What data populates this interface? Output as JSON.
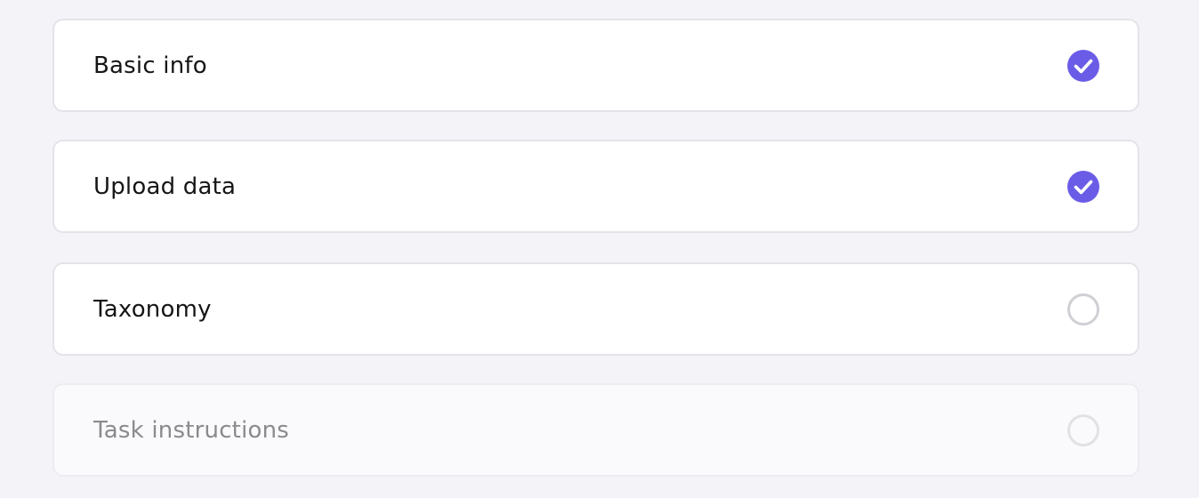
{
  "steps": [
    {
      "label": "Basic info",
      "status": "complete",
      "icon": "check-circle-icon"
    },
    {
      "label": "Upload data",
      "status": "complete",
      "icon": "check-circle-icon"
    },
    {
      "label": "Taxonomy",
      "status": "incomplete",
      "icon": "empty-circle-icon"
    },
    {
      "label": "Task instructions",
      "status": "disabled",
      "icon": "empty-circle-icon"
    }
  ],
  "colors": {
    "accent": "#6b5ce7",
    "incomplete_ring": "#cfcfd4",
    "disabled_ring": "#e1e1e6"
  }
}
